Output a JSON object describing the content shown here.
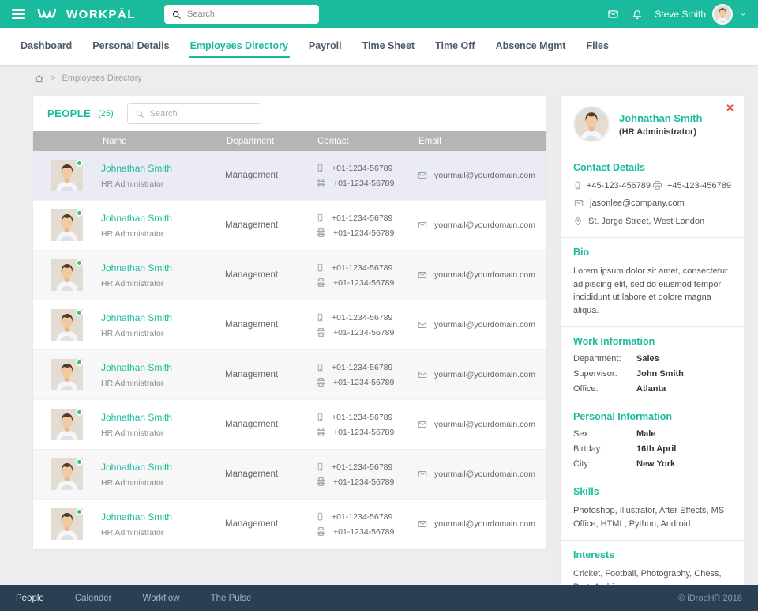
{
  "colors": {
    "accent": "#1ABB9C",
    "footer_bg": "#2A3F54",
    "selected_row": "#EBEBF5",
    "danger": "#E74C3C",
    "status_online": "#2DC76D"
  },
  "topbar": {
    "brand": "WORKPĀL",
    "search_placeholder": "Search",
    "user_name": "Steve Smith"
  },
  "nav": {
    "items": [
      {
        "label": "Dashboard"
      },
      {
        "label": "Personal Details"
      },
      {
        "label": "Employees Directory",
        "active": true
      },
      {
        "label": "Payroll"
      },
      {
        "label": "Time Sheet"
      },
      {
        "label": "Time Off"
      },
      {
        "label": "Absence Mgmt"
      },
      {
        "label": "Files"
      }
    ]
  },
  "breadcrumb": {
    "separator": ">",
    "current": "Employees Directory"
  },
  "people": {
    "title": "PEOPLE",
    "count": "(25)",
    "search_placeholder": "Search",
    "columns": [
      {
        "label": "Name"
      },
      {
        "label": "Department"
      },
      {
        "label": "Contact"
      },
      {
        "label": "Email"
      }
    ],
    "rows": [
      {
        "name": "Johnathan Smith",
        "role": "HR Administrator",
        "department": "Management",
        "phone": "+01-1234-56789",
        "fax": "+01-1234-56789",
        "email": "yourmail@yourdomain.com",
        "selected": true
      },
      {
        "name": "Johnathan Smith",
        "role": "HR Administrator",
        "department": "Management",
        "phone": "+01-1234-56789",
        "fax": "+01-1234-56789",
        "email": "yourmail@yourdomain.com"
      },
      {
        "name": "Johnathan Smith",
        "role": "HR Administrator",
        "department": "Management",
        "phone": "+01-1234-56789",
        "fax": "+01-1234-56789",
        "email": "yourmail@yourdomain.com"
      },
      {
        "name": "Johnathan Smith",
        "role": "HR Administrator",
        "department": "Management",
        "phone": "+01-1234-56789",
        "fax": "+01-1234-56789",
        "email": "yourmail@yourdomain.com"
      },
      {
        "name": "Johnathan Smith",
        "role": "HR Administrator",
        "department": "Management",
        "phone": "+01-1234-56789",
        "fax": "+01-1234-56789",
        "email": "yourmail@yourdomain.com"
      },
      {
        "name": "Johnathan Smith",
        "role": "HR Administrator",
        "department": "Management",
        "phone": "+01-1234-56789",
        "fax": "+01-1234-56789",
        "email": "yourmail@yourdomain.com"
      },
      {
        "name": "Johnathan Smith",
        "role": "HR Administrator",
        "department": "Management",
        "phone": "+01-1234-56789",
        "fax": "+01-1234-56789",
        "email": "yourmail@yourdomain.com"
      },
      {
        "name": "Johnathan Smith",
        "role": "HR Administrator",
        "department": "Management",
        "phone": "+01-1234-56789",
        "fax": "+01-1234-56789",
        "email": "yourmail@yourdomain.com"
      }
    ]
  },
  "profile": {
    "name": "Johnathan Smith",
    "role": "(HR Administrator)",
    "close_glyph": "✕",
    "contact": {
      "heading": "Contact Details",
      "phone": "+45-123-456789",
      "fax": "+45-123-456789",
      "email": "jasonlee@company.com",
      "address": "St. Jorge Street, West London"
    },
    "bio": {
      "heading": "Bio",
      "text": "Lorem ipsum dolor sit amet, consectetur adipiscing elit, sed do eiusmod tempor incididunt ut labore et dolore magna aliqua."
    },
    "work": {
      "heading": "Work Information",
      "fields": [
        {
          "label": "Department:",
          "value": "Sales"
        },
        {
          "label": "Supervisor:",
          "value": "John Smith"
        },
        {
          "label": "Office:",
          "value": "Atlanta"
        }
      ]
    },
    "personal": {
      "heading": "Personal Information",
      "fields": [
        {
          "label": "Sex:",
          "value": "Male"
        },
        {
          "label": "Birtday:",
          "value": "16th April"
        },
        {
          "label": "City:",
          "value": "New York"
        }
      ]
    },
    "skills": {
      "heading": "Skills",
      "text": "Photoshop, Illustrator, After Effects, MS Office, HTML, Python, Android"
    },
    "interests": {
      "heading": "Interests",
      "text": "Cricket, Football, Photography, Chess, Dart, Archiery"
    }
  },
  "footer": {
    "links": [
      {
        "label": "People",
        "active": true
      },
      {
        "label": "Calender"
      },
      {
        "label": "Workflow"
      },
      {
        "label": "The Pulse"
      }
    ],
    "copyright": "© iDropHR 2018"
  }
}
